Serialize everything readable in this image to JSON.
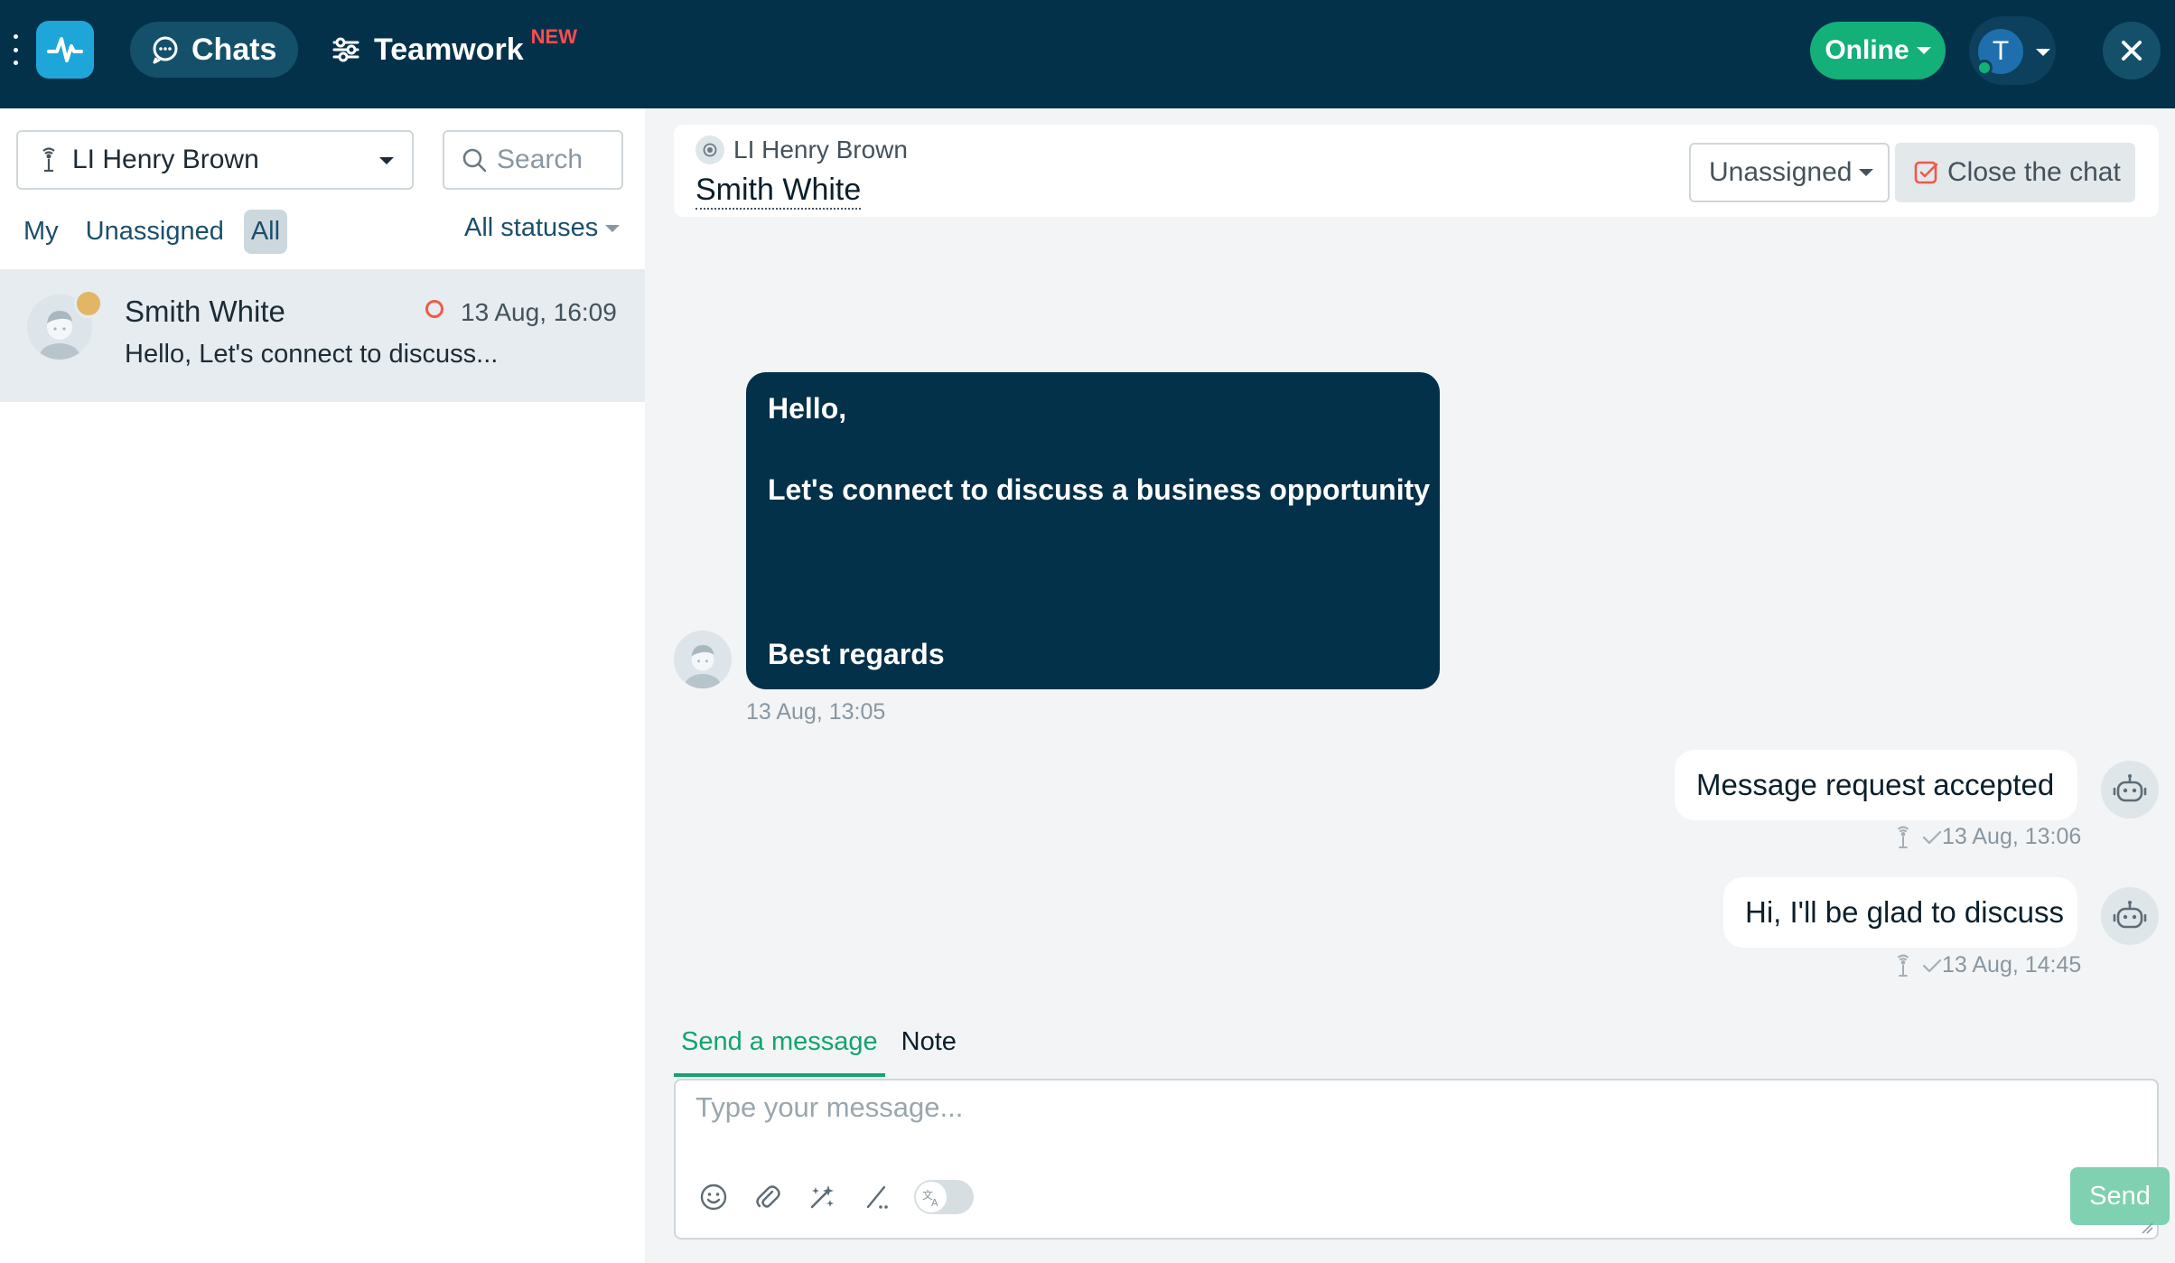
{
  "topbar": {
    "nav": {
      "chats_label": "Chats",
      "teamwork_label": "Teamwork",
      "teamwork_badge": "NEW"
    },
    "status_button": "Online",
    "user_initial": "T",
    "colors": {
      "bar": "#04314a",
      "online": "#13b07a",
      "badge": "#ff4c4c"
    }
  },
  "sidebar": {
    "account_select": "LI Henry Brown",
    "search_placeholder": "Search",
    "filters": [
      {
        "label": "My"
      },
      {
        "label": "Unassigned"
      },
      {
        "label": "All",
        "active": true
      }
    ],
    "status_filter": "All statuses",
    "chats": [
      {
        "name": "Smith White",
        "time": "13 Aug, 16:09",
        "preview": "Hello, Let's connect to discuss...",
        "unread": true
      }
    ]
  },
  "chat": {
    "account": "LI Henry Brown",
    "contact_name": "Smith White",
    "assign_select": "Unassigned",
    "close_button": "Close the chat",
    "messages": [
      {
        "direction": "incoming",
        "lines": [
          "Hello,",
          "Let's connect to discuss a business opportunity",
          "Best regards"
        ],
        "time": "13 Aug, 13:05"
      },
      {
        "direction": "outgoing",
        "text": "Message request accepted",
        "time": "13 Aug, 13:06"
      },
      {
        "direction": "outgoing",
        "text": "Hi, I'll be glad to discuss",
        "time": "13 Aug, 14:45"
      }
    ]
  },
  "composer": {
    "tabs": [
      {
        "label": "Send a message",
        "active": true
      },
      {
        "label": "Note"
      }
    ],
    "placeholder": "Type your message...",
    "send_label": "Send",
    "tools": [
      "emoji-icon",
      "attachment-icon",
      "magic-wand-icon",
      "slash-commands-icon",
      "translate-toggle"
    ]
  }
}
